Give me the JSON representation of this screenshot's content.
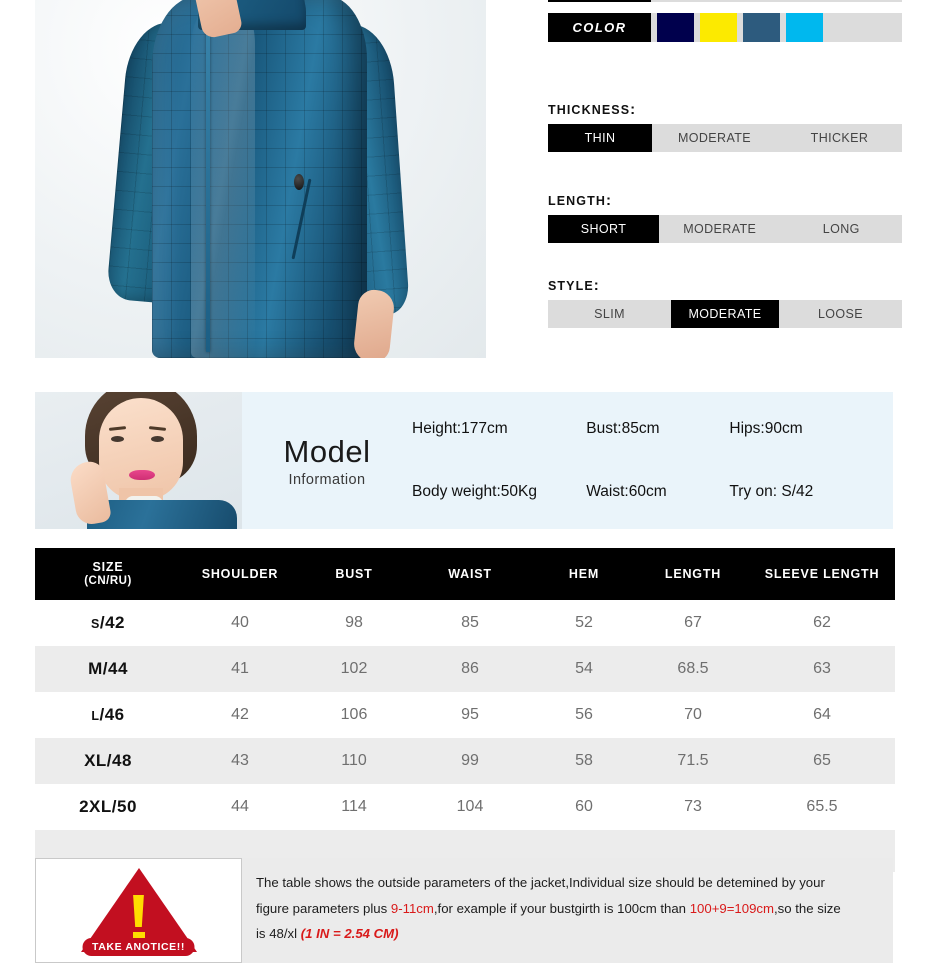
{
  "product_photo": {
    "alt": "blue quilted hooded jacket on model"
  },
  "options": {
    "color": {
      "label": "COLOR",
      "swatches": [
        {
          "name": "navy",
          "hex": "#00004d"
        },
        {
          "name": "yellow",
          "hex": "#fcea00"
        },
        {
          "name": "steel-blue",
          "hex": "#2d5b7e"
        },
        {
          "name": "cyan",
          "hex": "#00b8ee"
        }
      ]
    },
    "thickness": {
      "label": "THICKNESS",
      "colon": ":",
      "choices": [
        {
          "label": "THIN",
          "selected": true
        },
        {
          "label": "MODERATE",
          "selected": false
        },
        {
          "label": "THICKER",
          "selected": false
        }
      ]
    },
    "length": {
      "label": "LENGTH",
      "colon": ":",
      "choices": [
        {
          "label": "SHORT",
          "selected": true
        },
        {
          "label": "MODERATE",
          "selected": false
        },
        {
          "label": "LONG",
          "selected": false
        }
      ]
    },
    "style": {
      "label": "STYLE",
      "colon": ":",
      "choices": [
        {
          "label": "SLIM",
          "selected": false
        },
        {
          "label": "MODERATE",
          "selected": true
        },
        {
          "label": "LOOSE",
          "selected": false
        }
      ]
    }
  },
  "model": {
    "title": "Model",
    "subtitle": "Information",
    "specs": [
      {
        "label": "Height:",
        "value": "177cm"
      },
      {
        "label": "Bust:",
        "value": "85cm"
      },
      {
        "label": "Hips:",
        "value": "90cm"
      },
      {
        "label": "Body weight:",
        "value": "50Kg"
      },
      {
        "label": "Waist:",
        "value": "60cm"
      },
      {
        "label": "Try on:",
        "value": "S/42"
      }
    ]
  },
  "size_table": {
    "headers": [
      {
        "main": "SIZE",
        "sub": "(CN/RU)"
      },
      {
        "main": "SHOULDER"
      },
      {
        "main": "BUST"
      },
      {
        "main": "WAIST"
      },
      {
        "main": "HEM"
      },
      {
        "main": "LENGTH"
      },
      {
        "main": "SLEEVE LENGTH"
      }
    ],
    "rows": [
      {
        "size": "S/42",
        "size_pre": "S",
        "size_post": "/42",
        "shoulder": "40",
        "bust": "98",
        "waist": "85",
        "hem": "52",
        "length": "67",
        "sleeve": "62"
      },
      {
        "size": "M/44",
        "size_pre": "M",
        "size_post": "/44",
        "shoulder": "41",
        "bust": "102",
        "waist": "86",
        "hem": "54",
        "length": "68.5",
        "sleeve": "63"
      },
      {
        "size": "L/46",
        "size_pre": "L",
        "size_post": "/46",
        "shoulder": "42",
        "bust": "106",
        "waist": "95",
        "hem": "56",
        "length": "70",
        "sleeve": "64"
      },
      {
        "size": "XL/48",
        "size_pre": "XL",
        "size_post": "/48",
        "shoulder": "43",
        "bust": "110",
        "waist": "99",
        "hem": "58",
        "length": "71.5",
        "sleeve": "65"
      },
      {
        "size": "2XL/50",
        "size_pre": "2XL",
        "size_post": "/50",
        "shoulder": "44",
        "bust": "114",
        "waist": "104",
        "hem": "60",
        "length": "73",
        "sleeve": "65.5"
      }
    ]
  },
  "notice": {
    "badge": "TAKE ANOTICE!!",
    "line1_a": "The table shows the outside parameters of the jacket,Individual size should be detemined by your",
    "line2_a": "figure parameters plus ",
    "line2_hl": "9-11cm",
    "line2_b": ",for example if your bustgirth is 100cm than ",
    "line2_hl2": "100+9=109cm",
    "line2_c": ",so the size",
    "line3_a": "is 48/xl  ",
    "line3_hl": "(1 IN = 2.54 CM)"
  }
}
